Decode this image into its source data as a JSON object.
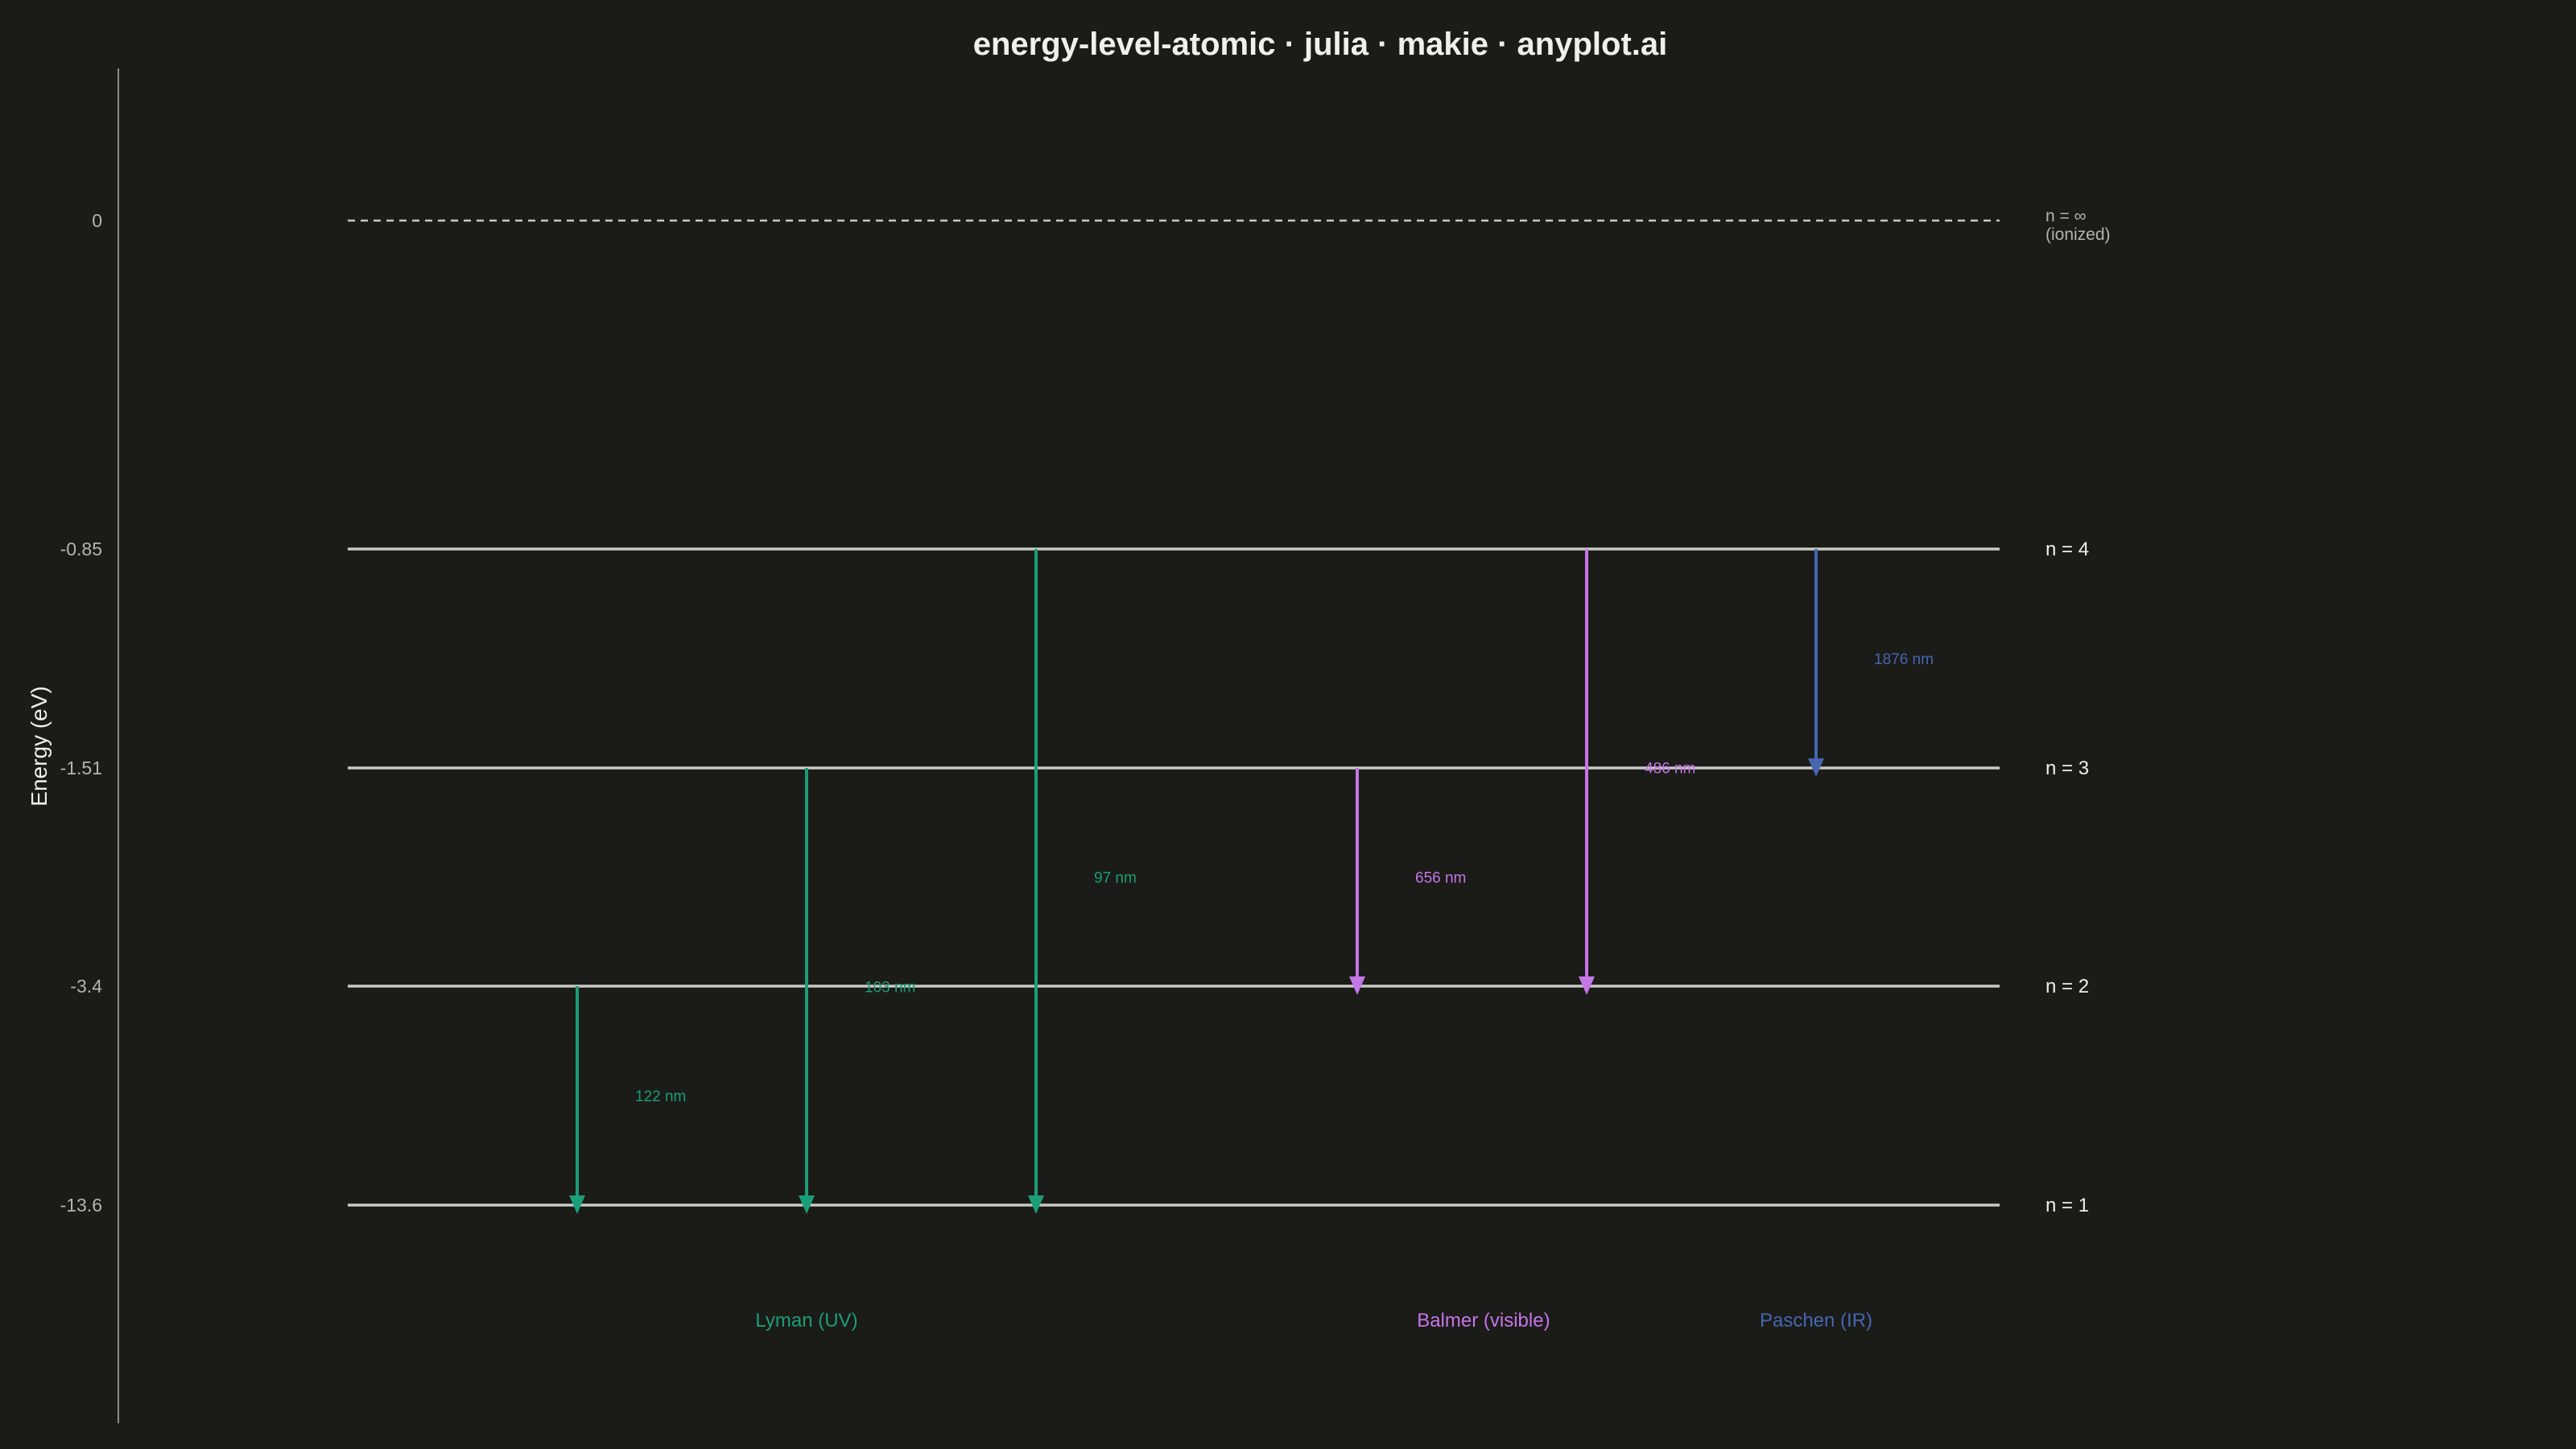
{
  "chart_data": {
    "type": "energy-level",
    "title": "energy-level-atomic · julia · makie · anyplot.ai",
    "ylabel": "Energy (eV)",
    "ionization": {
      "energy": 0,
      "tick_label": "0",
      "label_line1": "n = ∞",
      "label_line2": "(ionized)"
    },
    "levels": [
      {
        "n": 1,
        "energy": -13.6,
        "tick_label": "-13.6",
        "label": "n = 1"
      },
      {
        "n": 2,
        "energy": -3.4,
        "tick_label": "-3.4",
        "label": "n = 2"
      },
      {
        "n": 3,
        "energy": -1.51,
        "tick_label": "-1.51",
        "label": "n = 3"
      },
      {
        "n": 4,
        "energy": -0.85,
        "tick_label": "-0.85",
        "label": "n = 4"
      }
    ],
    "series": [
      {
        "name": "Lyman (UV)",
        "color": "#1a9e77"
      },
      {
        "name": "Balmer (visible)",
        "color": "#c475e8"
      },
      {
        "name": "Paschen (IR)",
        "color": "#4467b0"
      }
    ],
    "transitions": [
      {
        "series": "Lyman (UV)",
        "from": 2,
        "to": 1,
        "wavelength_label": "122 nm"
      },
      {
        "series": "Lyman (UV)",
        "from": 3,
        "to": 1,
        "wavelength_label": "103 nm"
      },
      {
        "series": "Lyman (UV)",
        "from": 4,
        "to": 1,
        "wavelength_label": "97 nm"
      },
      {
        "series": "Balmer (visible)",
        "from": 3,
        "to": 2,
        "wavelength_label": "656 nm"
      },
      {
        "series": "Balmer (visible)",
        "from": 4,
        "to": 2,
        "wavelength_label": "486 nm"
      },
      {
        "series": "Paschen (IR)",
        "from": 4,
        "to": 3,
        "wavelength_label": "1876 nm"
      }
    ],
    "grid": false,
    "colors": {
      "background": "#1b1b18",
      "text": "#f0f0ea",
      "muted_text": "#b4b4ae",
      "level_line": "#c9c9c3",
      "axis_line": "#8e8e88"
    }
  }
}
